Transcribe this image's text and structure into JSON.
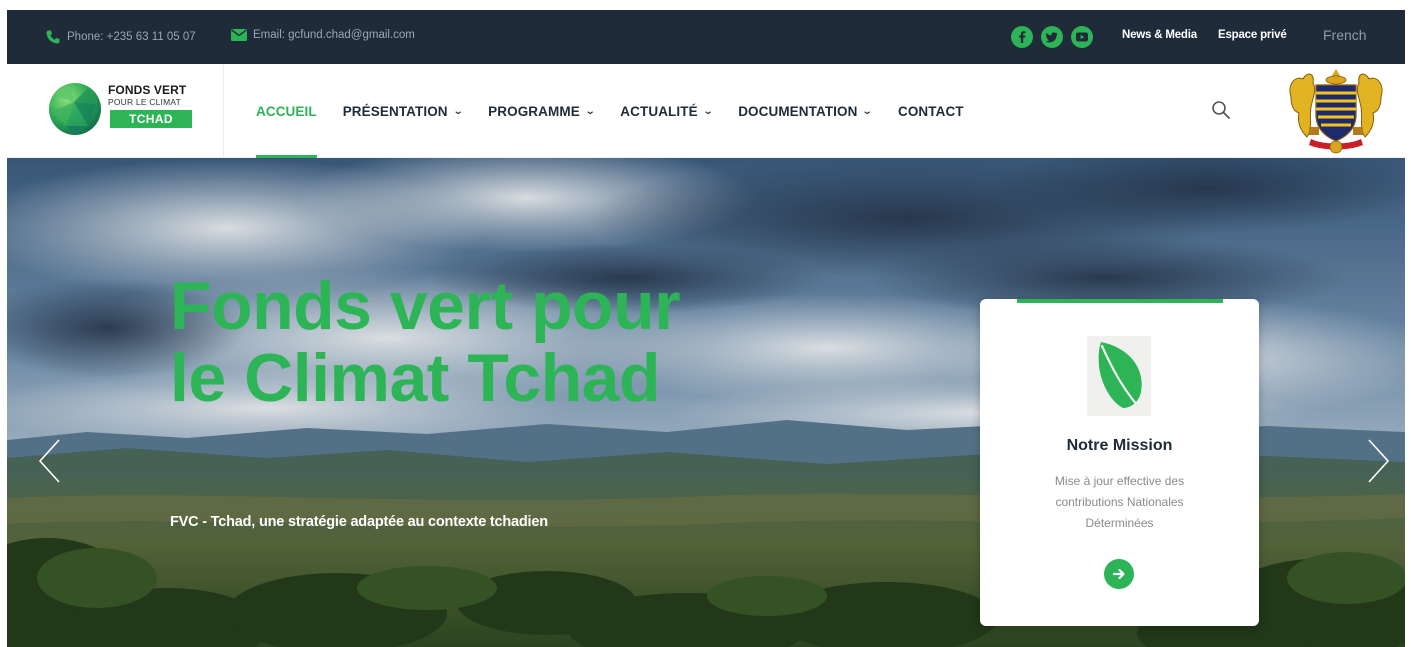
{
  "topbar": {
    "phone": "Phone: +235 63 11 05 07",
    "email": "Email: gcfund.chad@gmail.com",
    "socials": [
      "facebook-icon",
      "twitter-icon",
      "youtube-icon"
    ],
    "news_media": "News & Media",
    "espace_prive": "Espace privé",
    "language": "French"
  },
  "logo": {
    "line1": "FONDS VERT",
    "line2": "POUR LE CLIMAT",
    "line3": "TCHAD"
  },
  "nav": {
    "items": [
      {
        "label": "ACCUEIL",
        "active": true
      },
      {
        "label": "PRÉSENTATION",
        "dropdown": true
      },
      {
        "label": "PROGRAMME",
        "dropdown": true
      },
      {
        "label": "ACTUALITÉ",
        "dropdown": true
      },
      {
        "label": "DOCUMENTATION",
        "dropdown": true
      },
      {
        "label": "CONTACT"
      }
    ]
  },
  "hero": {
    "title": "Fonds vert pour le Climat Tchad",
    "subtitle": "FVC - Tchad, une stratégie adaptée au contexte tchadien"
  },
  "mission_card": {
    "title": "Notre Mission",
    "description": "Mise à jour effective des contributions Nationales Déterminées"
  },
  "colors": {
    "accent": "#2db457",
    "topbar_bg": "#1f2b38",
    "nav_text": "#1f2b38"
  }
}
